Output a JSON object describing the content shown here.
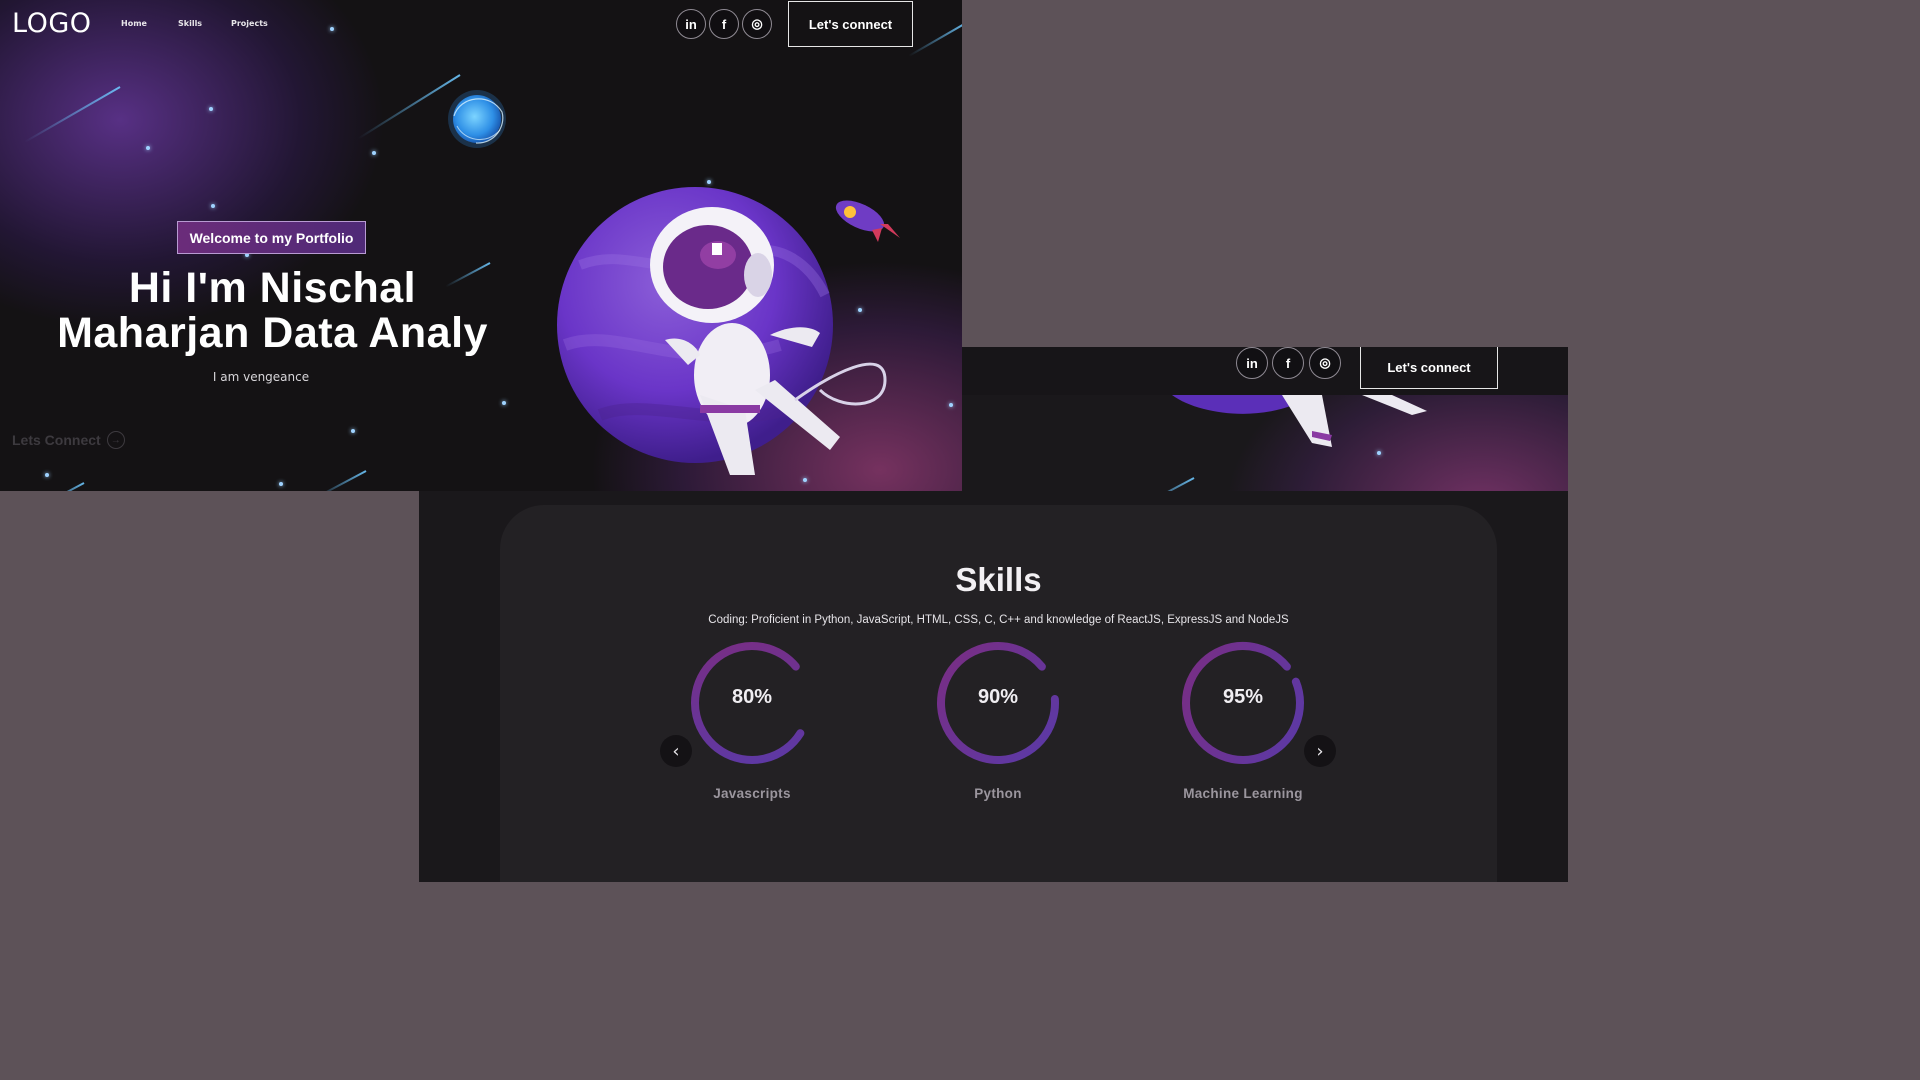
{
  "nav": {
    "logo": "LOGO",
    "links": [
      "Home",
      "Skills",
      "Projects"
    ],
    "social": [
      "in",
      "f",
      "◎"
    ],
    "connect_button": "Let's connect"
  },
  "hero": {
    "tagline": "Welcome to my Portfolio",
    "title_line1": "Hi I'm Nischal",
    "title_line2": "Maharjan Data Analy",
    "subtitle": "I am vengeance",
    "lets_connect": "Lets Connect"
  },
  "right_nav": {
    "social": [
      "in",
      "f",
      "◎"
    ],
    "connect_button": "Let's connect"
  },
  "skills": {
    "title": "Skills",
    "description": "Coding: Proficient in Python, JavaScript, HTML, CSS, C, C++ and knowledge of ReactJS, ExpressJS and NodeJS",
    "items": [
      {
        "percent_label": "80%",
        "name": "Javascripts",
        "value": 80
      },
      {
        "percent_label": "90%",
        "name": "Python",
        "value": 90
      },
      {
        "percent_label": "95%",
        "name": "Machine Learning",
        "value": 95
      }
    ],
    "prev_icon": "‹",
    "next_icon": "›"
  },
  "colors": {
    "ring_start": "#7a2d82",
    "ring_end": "#5a3aa8",
    "accent_purple": "#5b2d7a"
  }
}
